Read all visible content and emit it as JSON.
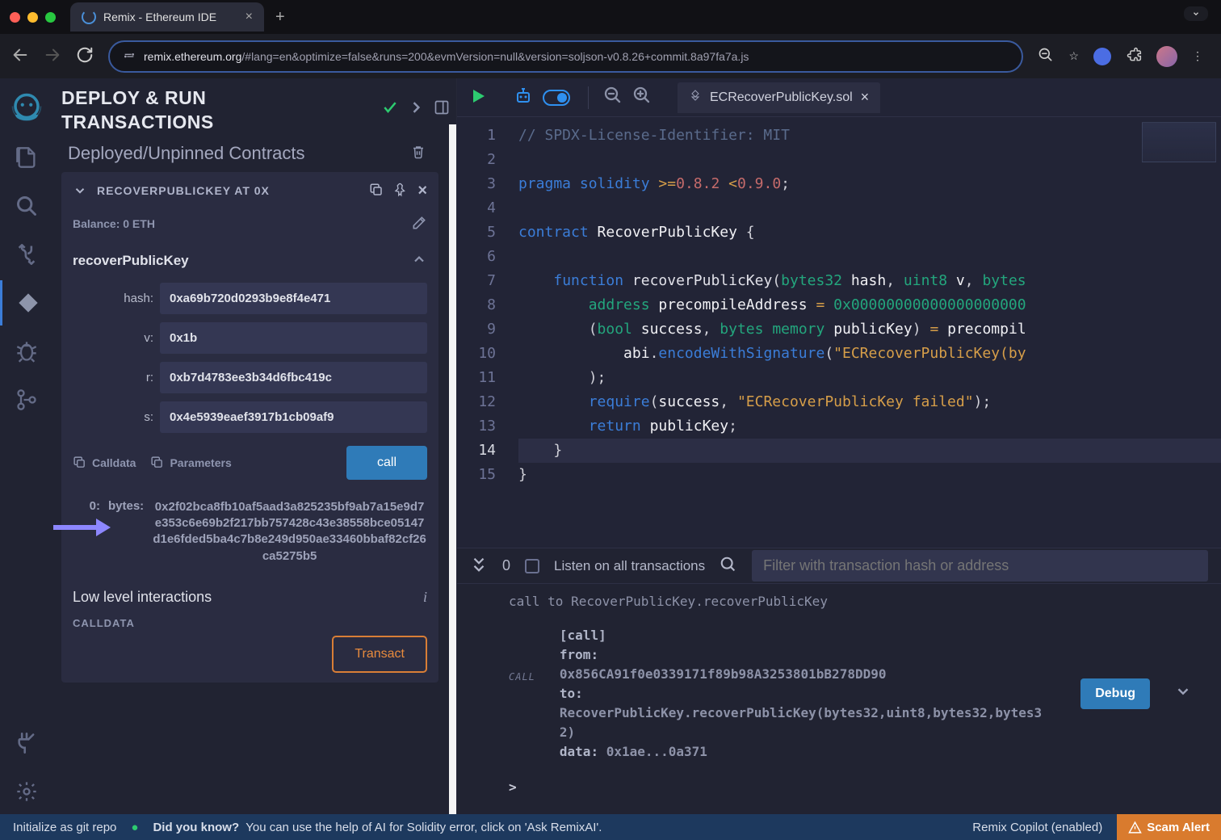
{
  "browser": {
    "tab_title": "Remix - Ethereum IDE",
    "url_host": "remix.ethereum.org",
    "url_path": "/#lang=en&optimize=false&runs=200&evmVersion=null&version=soljson-v0.8.26+commit.8a97fa7a.js"
  },
  "panel": {
    "title_line1": "DEPLOY & RUN",
    "title_line2": "TRANSACTIONS",
    "subtitle": "Deployed/Unpinned Contracts",
    "contract_name": "RECOVERPUBLICKEY AT 0X",
    "balance_label": "Balance:",
    "balance_value": "0 ETH",
    "function_name": "recoverPublicKey",
    "inputs": {
      "hash": {
        "label": "hash:",
        "value": "0xa69b720d0293b9e8f4e471"
      },
      "v": {
        "label": "v:",
        "value": "0x1b"
      },
      "r": {
        "label": "r:",
        "value": "0xb7d4783ee3b34d6fbc419c"
      },
      "s": {
        "label": "s:",
        "value": "0x4e5939eaef3917b1cb09af9"
      }
    },
    "calldata_label": "Calldata",
    "parameters_label": "Parameters",
    "call_label": "call",
    "output_idx": "0:",
    "output_type": "bytes:",
    "output_value": "0x2f02bca8fb10af5aad3a825235bf9ab7a15e9d7e353c6e69b2f217bb757428c43e38558bce05147d1e6fded5ba4c7b8e249d950ae33460bbaf82cf26ca5275b5",
    "low_level_title": "Low level interactions",
    "calldata_title": "CALLDATA",
    "transact_label": "Transact"
  },
  "editor": {
    "file_name": "ECRecoverPublicKey.sol",
    "lines": [
      "// SPDX-License-Identifier: MIT",
      "",
      "pragma solidity >=0.8.2 <0.9.0;",
      "",
      "contract RecoverPublicKey {",
      "",
      "    function recoverPublicKey(bytes32 hash, uint8 v, bytes",
      "        address precompileAddress = 0x00000000000000000000",
      "        (bool success, bytes memory publicKey) = precompil",
      "            abi.encodeWithSignature(\"ECRecoverPublicKey(by",
      "        );",
      "        require(success, \"ECRecoverPublicKey failed\");",
      "        return publicKey;",
      "    }",
      "}"
    ],
    "line_count": 15,
    "current_line": 14
  },
  "terminal": {
    "counter": "0",
    "listen_label": "Listen on all transactions",
    "filter_placeholder": "Filter with transaction hash or address",
    "line1": "call to RecoverPublicKey.recoverPublicKey",
    "block": {
      "tag": "CALL",
      "call_label": "[call]",
      "from_label": "from:",
      "from": "0x856CA91f0e0339171f89b98A3253801bB278DD90",
      "to_label": "to:",
      "to": "RecoverPublicKey.recoverPublicKey(bytes32,uint8,bytes32,bytes32)",
      "data_label": "data:",
      "data": "0x1ae...0a371"
    },
    "debug_label": "Debug",
    "prompt": ">"
  },
  "footer": {
    "git": "Initialize as git repo",
    "tip_label": "Did you know?",
    "tip": "You can use the help of AI for Solidity error, click on 'Ask RemixAI'.",
    "copilot": "Remix Copilot (enabled)",
    "scam": "Scam Alert"
  }
}
